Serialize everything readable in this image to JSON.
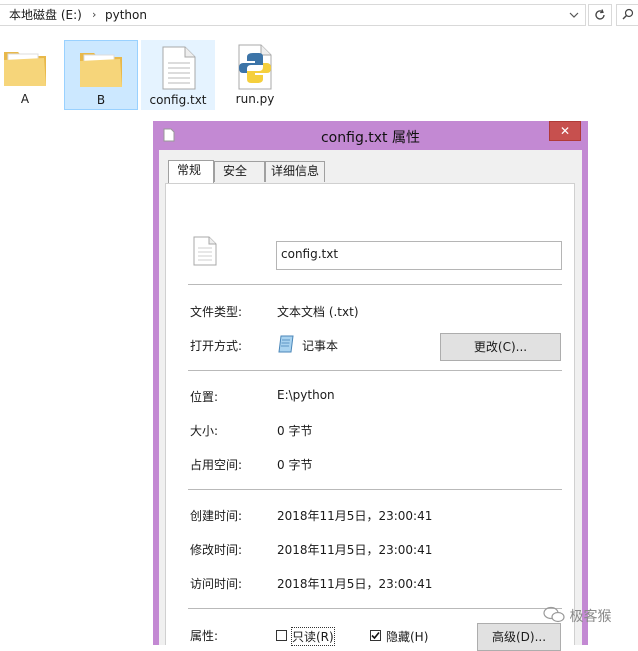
{
  "explorer": {
    "breadcrumb": [
      "本地磁盘 (E:)",
      "python"
    ],
    "breadcrumb_sep": "›",
    "items": [
      {
        "label": "A",
        "type": "folder"
      },
      {
        "label": "B",
        "type": "folder",
        "selected": true
      },
      {
        "label": "config.txt",
        "type": "text-file",
        "hover": true
      },
      {
        "label": "run.py",
        "type": "python-file"
      }
    ]
  },
  "dialog": {
    "title": "config.txt 属性",
    "close_glyph": "✕",
    "tabs": [
      "常规",
      "安全",
      "详细信息"
    ],
    "active_tab": "常规",
    "filename": "config.txt",
    "file_type_label": "文件类型:",
    "file_type_value": "文本文档 (.txt)",
    "open_with_label": "打开方式:",
    "open_with_value": "记事本",
    "change_button": "更改(C)...",
    "location_label": "位置:",
    "location_value": "E:\\python",
    "size_label": "大小:",
    "size_value": "0 字节",
    "disk_size_label": "占用空间:",
    "disk_size_value": "0 字节",
    "created_label": "创建时间:",
    "created_value": "2018年11月5日，23:00:41",
    "modified_label": "修改时间:",
    "modified_value": "2018年11月5日，23:00:41",
    "accessed_label": "访问时间:",
    "accessed_value": "2018年11月5日，23:00:41",
    "attributes_label": "属性:",
    "readonly_label": "只读(R)",
    "readonly_checked": false,
    "hidden_label": "隐藏(H)",
    "hidden_checked": true,
    "advanced_button": "高级(D)..."
  },
  "watermark": "极客猴",
  "colors": {
    "title_bar": "#c389d3",
    "close_button": "#c7504e",
    "selection": "#cce8ff",
    "folder": "#f3c95a"
  }
}
